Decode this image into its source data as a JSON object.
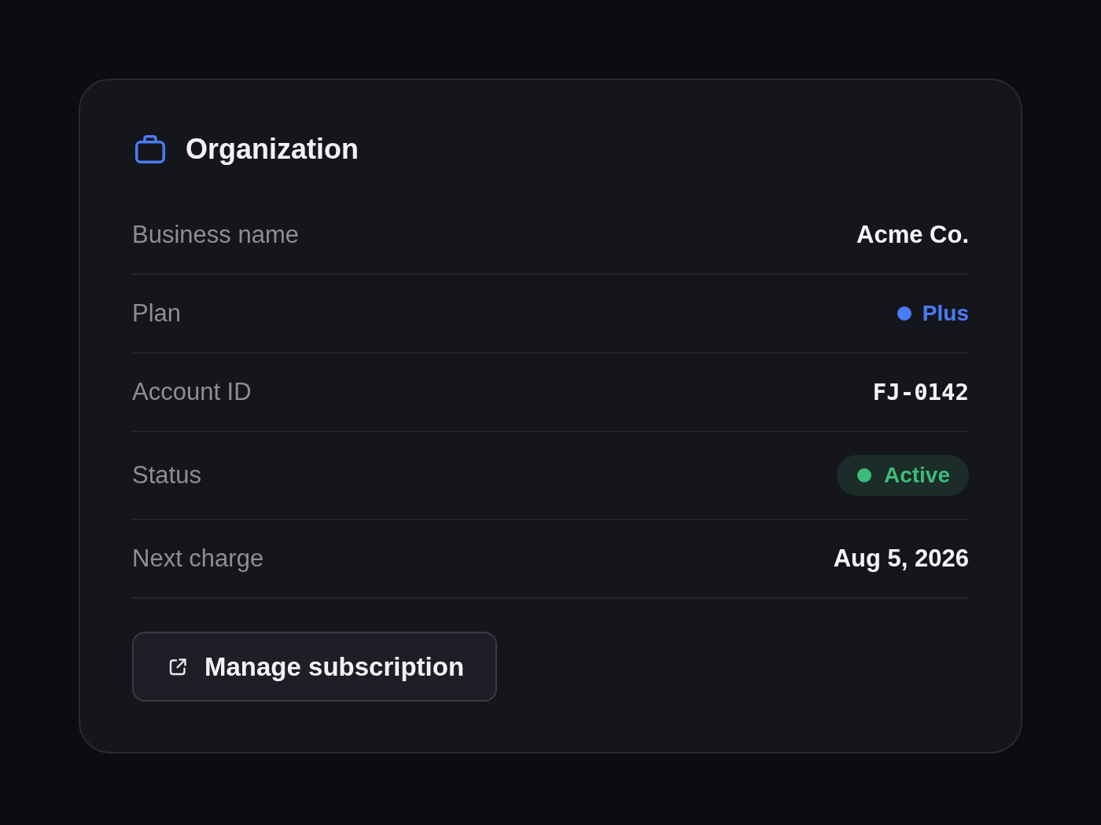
{
  "card": {
    "title": "Organization",
    "rows": [
      {
        "label": "Business name",
        "kind": "text",
        "value": "Acme Co."
      },
      {
        "label": "Plan",
        "kind": "dot",
        "value": "Plus",
        "color": "#4a7cf6"
      },
      {
        "label": "Account ID",
        "kind": "mono",
        "value": "FJ-0142"
      },
      {
        "label": "Status",
        "kind": "badge",
        "value": "Active",
        "color": "#3dbb78"
      },
      {
        "label": "Next charge",
        "kind": "text",
        "value": "Aug 5, 2026"
      }
    ],
    "button": {
      "label": "Manage subscription"
    }
  }
}
